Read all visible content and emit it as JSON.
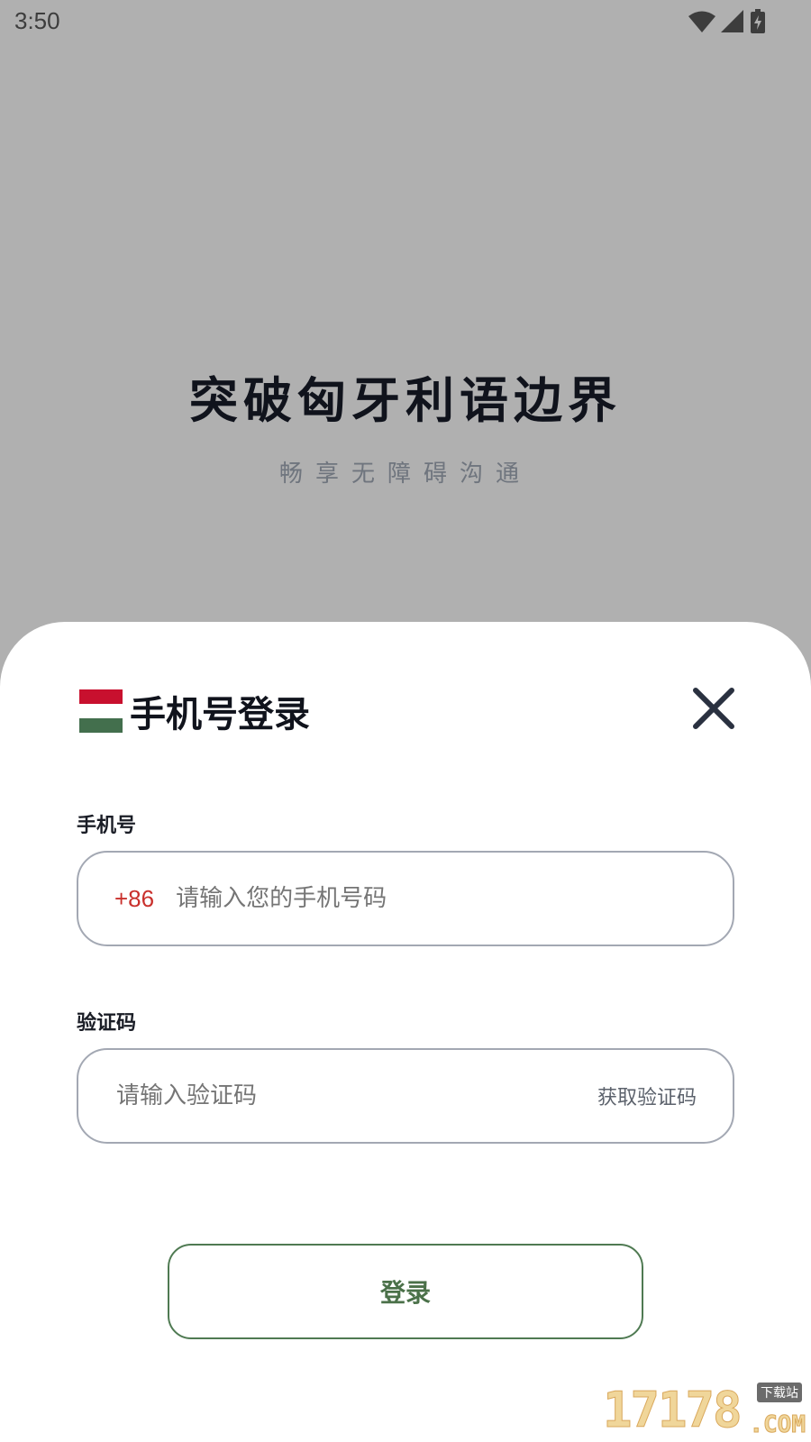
{
  "status_bar": {
    "time": "3:50",
    "icons": [
      "wifi-icon",
      "signal-icon",
      "battery-charging-icon"
    ]
  },
  "hero": {
    "title": "突破匈牙利语边界",
    "subtitle": "畅享无障碍沟通"
  },
  "sheet": {
    "title": "手机号登录",
    "flag_colors": [
      "#c8102e",
      "#ffffff",
      "#436f4d"
    ],
    "close_icon": "close-icon"
  },
  "phone": {
    "label": "手机号",
    "country_code": "+86",
    "placeholder": "请输入您的手机号码"
  },
  "code": {
    "label": "验证码",
    "placeholder": "请输入验证码",
    "get_code": "获取验证码"
  },
  "login": {
    "label": "登录"
  },
  "watermark": {
    "number": "17178",
    "download": "下载站",
    "com": ".COM"
  },
  "colors": {
    "accent_green": "#4b7149",
    "country_code_red": "#c9302c",
    "overlay_gray": "#b0b0b0"
  }
}
